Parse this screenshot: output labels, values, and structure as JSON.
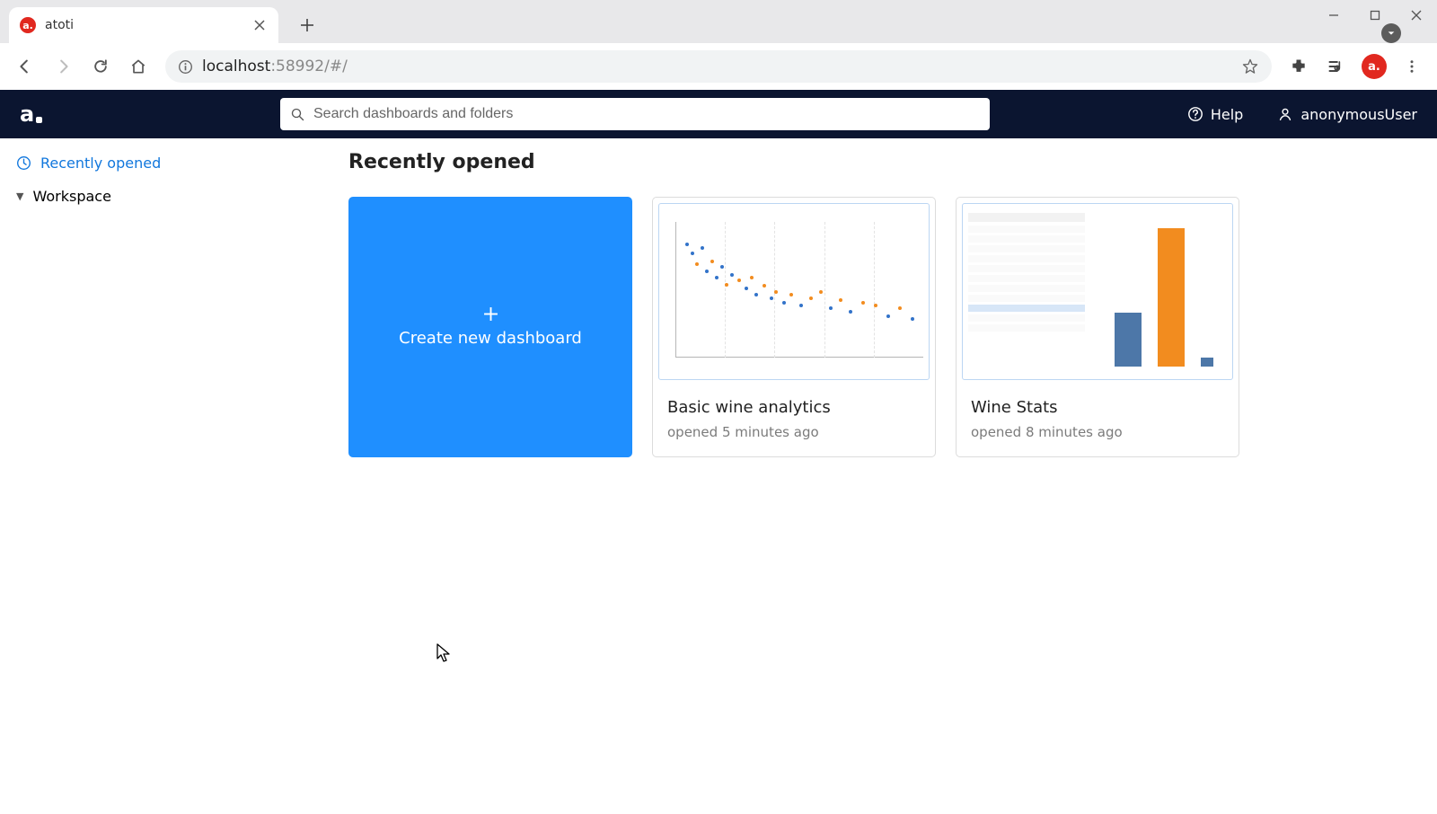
{
  "browser": {
    "tab_title": "atoti",
    "url": {
      "host": "localhost",
      "port_path": ":58992/#/"
    }
  },
  "app": {
    "search_placeholder": "Search dashboards and folders",
    "help_label": "Help",
    "user_label": "anonymousUser"
  },
  "sidebar": {
    "recently_opened": "Recently opened",
    "workspace": "Workspace"
  },
  "main": {
    "section_title": "Recently opened",
    "create_label": "Create new dashboard",
    "cards": [
      {
        "title": "Basic wine analytics",
        "subtitle": "opened 5 minutes ago"
      },
      {
        "title": "Wine Stats",
        "subtitle": "opened 8 minutes ago"
      }
    ]
  }
}
